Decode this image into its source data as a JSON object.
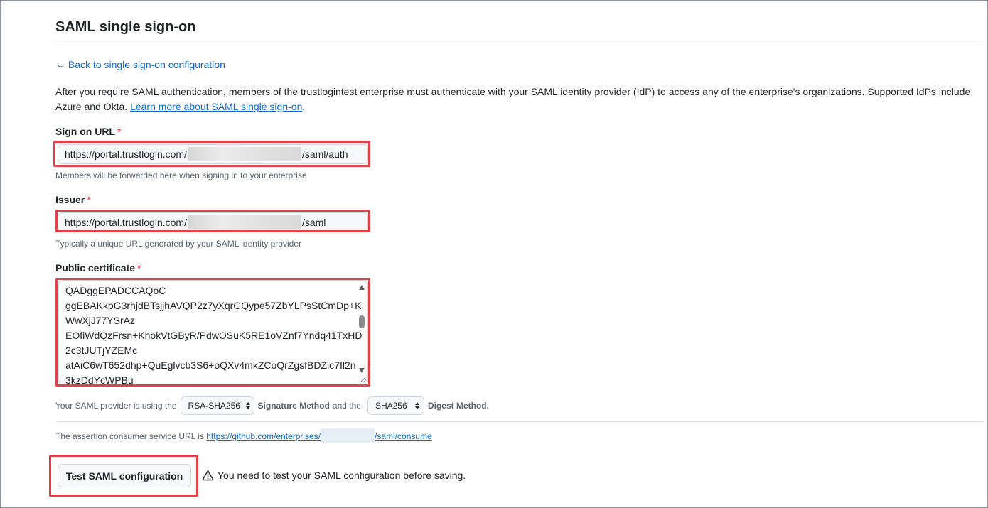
{
  "page": {
    "title": "SAML single sign-on",
    "back_link": "← Back to single sign-on configuration",
    "intro_text": "After you require SAML authentication, members of the trustlogintest enterprise must authenticate with your SAML identity provider (IdP) to access any of the enterprise's organizations. Supported IdPs include Azure and Okta. ",
    "intro_link": "Learn more about SAML single sign-on",
    "intro_end": "."
  },
  "sign_on_url": {
    "label": "Sign on URL",
    "required": "*",
    "value_prefix": "https://portal.trustlogin.com/",
    "value_suffix": "/saml/auth",
    "hint": "Members will be forwarded here when signing in to your enterprise"
  },
  "issuer": {
    "label": "Issuer",
    "required": "*",
    "value_prefix": "https://portal.trustlogin.com/",
    "value_suffix": "/saml",
    "hint": "Typically a unique URL generated by your SAML identity provider"
  },
  "certificate": {
    "label": "Public certificate",
    "required": "*",
    "lines": [
      "QADggEPADCCAQoC",
      "ggEBAKkbG3rhjdBTsjjhAVQP2z7yXqrGQype57ZbYLPsStCmDp+K",
      "WwXjJ77YSrAz",
      "EOfiWdQzFrsn+KhokVtGByR/PdwOSuK5RE1oVZnf7Yndq41TxHD",
      "2c3tJUTjYZEMc",
      "atAiC6wT652dhp+QuEglvcb3S6+oQXv4mkZCoQrZgsfBDZic7Il2n",
      "3kzDdYcWPBu"
    ]
  },
  "methods": {
    "text_before": "Your SAML provider is using the",
    "signature_value": "RSA-SHA256",
    "signature_label": "Signature Method",
    "text_middle": "and the",
    "digest_value": "SHA256",
    "digest_label": "Digest Method."
  },
  "acs": {
    "text": "The assertion consumer service URL is ",
    "link_prefix": "https://github.com/enterprises/",
    "link_suffix": "/saml/consume"
  },
  "actions": {
    "test_button": "Test SAML configuration",
    "warning": "You need to test your SAML configuration before saving."
  },
  "colors": {
    "link": "#0969da",
    "required": "#cf222e",
    "highlight": "#e0424a"
  }
}
